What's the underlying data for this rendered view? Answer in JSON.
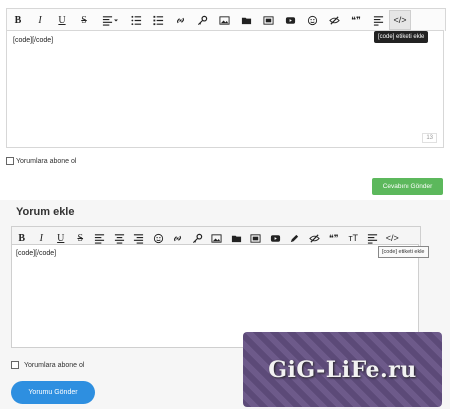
{
  "top": {
    "editor_text": "[code][/code]",
    "counter": "13",
    "tooltip": "[code] etiketi ekle",
    "subscribe_label": "Yorumlara abone ol",
    "submit_label": "Cevabını Gönder"
  },
  "bottom": {
    "heading": "Yorum ekle",
    "editor_text": "[code][/code]",
    "tooltip": "[code] etiketi ekle",
    "subscribe_label": "Yorumlara abone ol",
    "submit_label": "Yorumu Gönder"
  },
  "toolbar_glyphs": {
    "bold": "B",
    "italic": "I",
    "underline": "U",
    "strike": "S",
    "quote": "❝❞",
    "code": "</>",
    "superscript": "ᴛT"
  },
  "watermark": {
    "text": "GiG-LiFe.ru"
  },
  "colors": {
    "top_submit_bg": "#5cb85c",
    "bottom_submit_bg": "#2e8fe0",
    "tooltip_dark": "#222222"
  }
}
